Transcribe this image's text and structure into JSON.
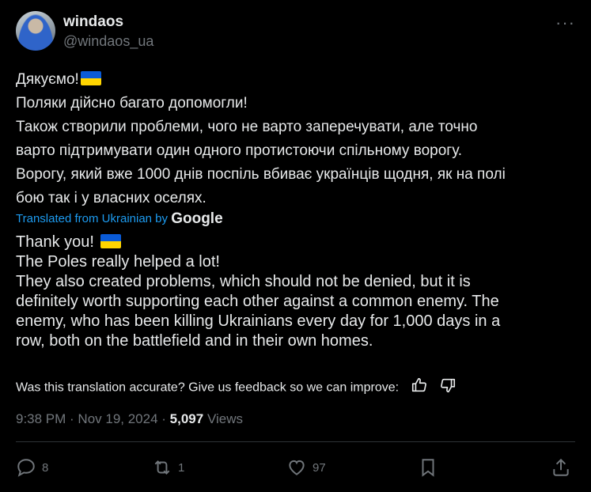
{
  "author": {
    "display_name": "windaos",
    "handle": "@windaos_ua"
  },
  "more_icon": "···",
  "original_text": [
    "Дякуємо!",
    "Поляки дійсно багато допомогли!",
    "Також створили проблеми, чого не варто заперечувати, але точно",
    "варто підтримувати один одного протистоючи спільному ворогу.",
    "Ворогу, який вже 1000 днів поспіль вбиває українців щодня, як на полі",
    "бою так і у власних оселях."
  ],
  "translation_note": {
    "label": "Translated from Ukrainian by",
    "provider": "Google"
  },
  "translated_text": [
    "Thank you!",
    "The Poles really helped a lot!",
    "They also created problems, which should not be denied, but it is",
    "definitely worth supporting each other against a common enemy. The",
    "enemy, who has been killing Ukrainians every day for 1,000 days in a",
    "row, both on the battlefield and in their own homes."
  ],
  "feedback": {
    "text": "Was this translation accurate? Give us feedback so we can improve:"
  },
  "meta": {
    "time": "9:38 PM",
    "sep": " · ",
    "date": "Nov 19, 2024",
    "views_count": "5,097",
    "views_label": " Views"
  },
  "actions": {
    "replies": "8",
    "retweets": "1",
    "likes": "97"
  },
  "colors": {
    "background": "#000000",
    "text": "#e7e9ea",
    "muted": "#71767b",
    "link": "#1d9bf0",
    "flag_blue": "#0a5bd7",
    "flag_yellow": "#ffd500"
  }
}
